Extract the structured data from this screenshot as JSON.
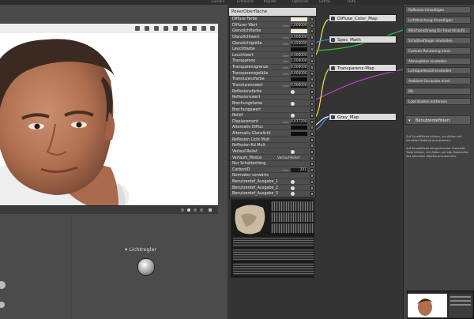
{
  "top_tabs": [
    "Loaden",
    "Erklärens",
    "Kapitel",
    "Optionen",
    "Extras",
    "Hilfe"
  ],
  "node": {
    "title": "PoserOberfläche",
    "rows": [
      {
        "label": "Diffuse Farbe",
        "kind": "color-light",
        "tag": "",
        "value": ""
      },
      {
        "label": "Diffuser Wert",
        "kind": "value",
        "tag": "Grm",
        "value": "1,000000"
      },
      {
        "label": "Glanzlichtfarbe",
        "kind": "color-light",
        "tag": "",
        "value": ""
      },
      {
        "label": "Glanzlichtwert",
        "kind": "value",
        "tag": "Grm",
        "value": "0,000000"
      },
      {
        "label": "Glanzlichtgröße",
        "kind": "value",
        "tag": "Grm",
        "value": "0,050000"
      },
      {
        "label": "Leuchtfarbe",
        "kind": "color-dark",
        "tag": "",
        "value": ""
      },
      {
        "label": "Leuchtwert",
        "kind": "value",
        "tag": "Grm",
        "value": "0,000000"
      },
      {
        "label": "Transparenz",
        "kind": "value",
        "tag": "Grm",
        "value": "1,000000"
      },
      {
        "label": "Transparenzgrenze",
        "kind": "value",
        "tag": "Grm",
        "value": "0,000000"
      },
      {
        "label": "Transparenzgefälle",
        "kind": "value",
        "tag": "Grm",
        "value": "0,000000"
      },
      {
        "label": "Transluzenzfarbe",
        "kind": "color-dark",
        "tag": "",
        "value": ""
      },
      {
        "label": "Transluzenzwert",
        "kind": "value",
        "tag": "Grm",
        "value": "0,000000"
      },
      {
        "label": "Reflexionsfarbe",
        "kind": "knob",
        "tag": "",
        "value": ""
      },
      {
        "label": "Reflexionswert",
        "kind": "none",
        "tag": "",
        "value": ""
      },
      {
        "label": "Brechungsfarbe",
        "kind": "knob",
        "tag": "",
        "value": ""
      },
      {
        "label": "Brechungswert",
        "kind": "none",
        "tag": "",
        "value": ""
      },
      {
        "label": "Relief",
        "kind": "knob",
        "tag": "",
        "value": ""
      },
      {
        "label": "Displacement",
        "kind": "value",
        "tag": "Grm",
        "value": "0,017200"
      },
      {
        "label": "Alternativ Diffus",
        "kind": "color-dark",
        "tag": "",
        "value": ""
      },
      {
        "label": "Alternativ Glanzlicht",
        "kind": "color-dark",
        "tag": "",
        "value": ""
      },
      {
        "label": "Reflexion Licht Mult",
        "kind": "none",
        "tag": "",
        "value": ""
      },
      {
        "label": "Reflexion Kd Mult",
        "kind": "none",
        "tag": "",
        "value": ""
      },
      {
        "label": "Verlauf-Relief",
        "kind": "knob",
        "tag": "",
        "value": ""
      },
      {
        "label": "Verlaufs_Modus",
        "kind": "text",
        "tag": "",
        "value": "Verlauf-Relief"
      },
      {
        "label": "Nur Schattenfang",
        "kind": "none",
        "tag": "",
        "value": ""
      },
      {
        "label": "CarbonID",
        "kind": "value",
        "tag": "Grm",
        "value": "201"
      },
      {
        "label": "Normalen vorwärts",
        "kind": "none",
        "tag": "",
        "value": ""
      },
      {
        "label": "Benutzerdef_Ausgabe_1",
        "kind": "knob",
        "tag": "",
        "value": ""
      },
      {
        "label": "Benutzerdef_Ausgabe_2",
        "kind": "knob",
        "tag": "",
        "value": ""
      },
      {
        "label": "Benutzerdef_Ausgabe_3",
        "kind": "knob",
        "tag": "",
        "value": ""
      }
    ]
  },
  "map_nodes": [
    {
      "label": "Diffuse_Color_Map"
    },
    {
      "label": "Spec_Math"
    },
    {
      "label": "Transparenz-Map"
    },
    {
      "label": "Grey_Map"
    }
  ],
  "wire_colors": [
    "#e8e84a",
    "#3d8be8",
    "#2ec43c",
    "#c040c0",
    "#e8e8e8"
  ],
  "light_label": "Lichtregler",
  "right_buttons": [
    "Reflexion hinzufügen",
    "Lichtbrechung hinzufügen",
    "Weichzeichnung für Haut hinzufü...",
    "Schattenfänger einstellen",
    "Cartoon-Rendering einst.",
    "Atmosphäre einstellen",
    "Lichtquellenzill einstellen",
    "Ambient Occlusion einst.",
    "IBL",
    "Lose Knoten entfernen"
  ],
  "benutzer_label": "Benutzerdefiniert",
  "help_texts": [
    "Auf Schaltfläche klicken, um Aktion auf aktuelles Material anzuwenden.",
    "Auf Schaltfläche bei gedrückter Umschalt-Taste klicken, um Aktion auf alle Materialien des aktuellen Objekts anzuwenden."
  ]
}
